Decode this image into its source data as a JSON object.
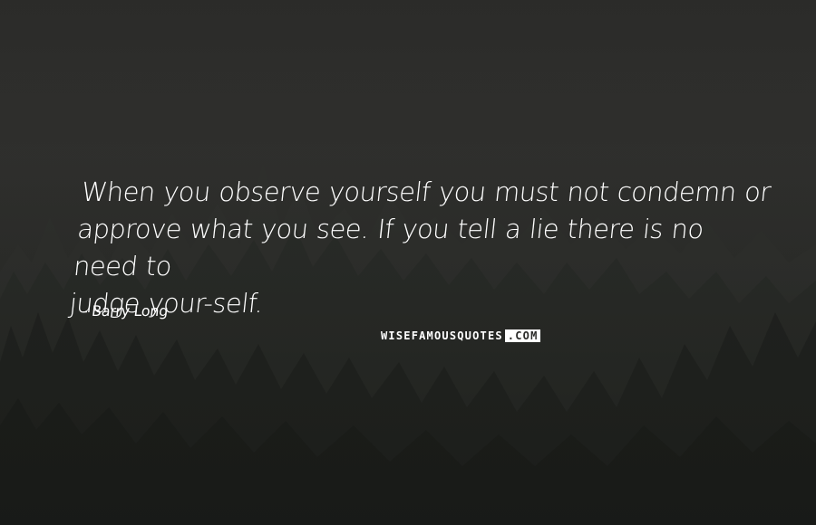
{
  "quote": {
    "lines": [
      "When you observe yourself you must not condemn or",
      "approve what you see. If you tell a lie there is no need to",
      "judge your-self."
    ]
  },
  "author": {
    "name": "- Barry Long"
  },
  "watermark": {
    "main": "WISEFAMOUSQUOTES",
    "tld": ".COM"
  },
  "colors": {
    "text": "#ffffff",
    "sky": "#2f2f2d",
    "forest": "#1c1e1b"
  }
}
